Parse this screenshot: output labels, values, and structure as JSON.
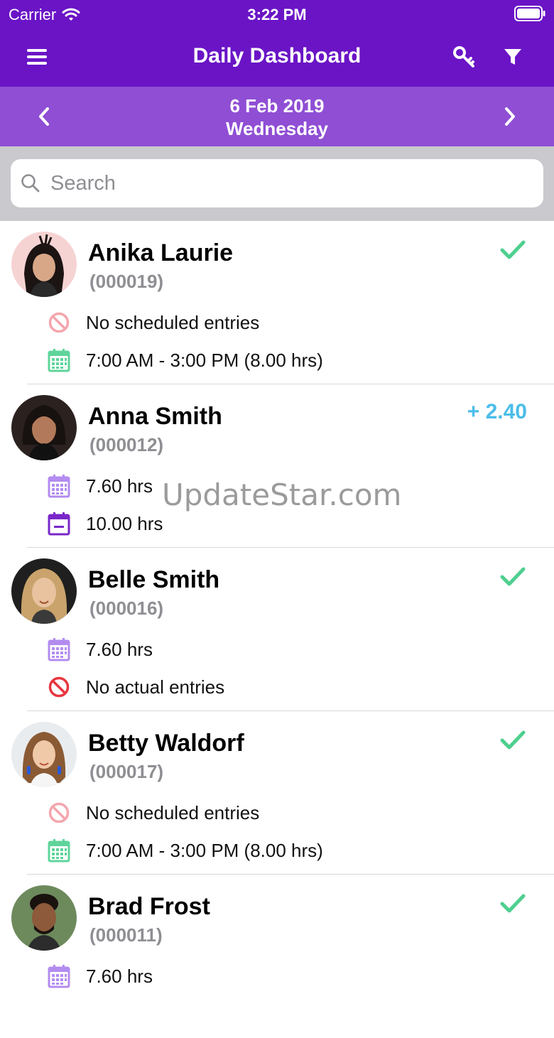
{
  "status_bar": {
    "carrier": "Carrier",
    "time": "3:22 PM"
  },
  "nav": {
    "title": "Daily Dashboard",
    "menu_icon": "hamburger-menu-icon",
    "key_icon": "key-icon",
    "filter_icon": "filter-icon"
  },
  "date": {
    "line1": "6 Feb 2019",
    "line2": "Wednesday"
  },
  "search": {
    "placeholder": "Search",
    "value": ""
  },
  "colors": {
    "header": "#6a14c6",
    "datebar": "#8f4ed4",
    "check_green": "#4fcf8f",
    "positive_blue": "#4bbde8",
    "scheduled_purple": "#b38cf0",
    "actual_purple": "#7a27c9",
    "calendar_green": "#5fd49a",
    "no_entry_red": "#e8353f",
    "no_entry_pink": "#f4a6ad"
  },
  "employees": [
    {
      "name": "Anika Laurie",
      "code": "(000019)",
      "status": "check",
      "status_value": "",
      "row1": {
        "icon": "no-entries-icon",
        "text": "No scheduled entries"
      },
      "row2": {
        "icon": "calendar-green-icon",
        "text": "7:00 AM - 3:00 PM (8.00 hrs)"
      }
    },
    {
      "name": "Anna Smith",
      "code": "(000012)",
      "status": "value",
      "status_value": "+ 2.40",
      "row1": {
        "icon": "calendar-scheduled-icon",
        "text": "7.60 hrs"
      },
      "row2": {
        "icon": "calendar-actual-icon",
        "text": "10.00 hrs"
      }
    },
    {
      "name": "Belle Smith",
      "code": "(000016)",
      "status": "check",
      "status_value": "",
      "row1": {
        "icon": "calendar-scheduled-icon",
        "text": "7.60 hrs"
      },
      "row2": {
        "icon": "no-entries-red-icon",
        "text": "No actual entries"
      }
    },
    {
      "name": "Betty Waldorf",
      "code": "(000017)",
      "status": "check",
      "status_value": "",
      "row1": {
        "icon": "no-entries-icon",
        "text": "No scheduled entries"
      },
      "row2": {
        "icon": "calendar-green-icon",
        "text": "7:00 AM - 3:00 PM (8.00 hrs)"
      }
    },
    {
      "name": "Brad Frost",
      "code": "(000011)",
      "status": "check",
      "status_value": "",
      "row1": {
        "icon": "calendar-scheduled-icon",
        "text": "7.60 hrs"
      },
      "row2": {
        "icon": "",
        "text": ""
      }
    }
  ],
  "watermark": "UpdateStar.com"
}
